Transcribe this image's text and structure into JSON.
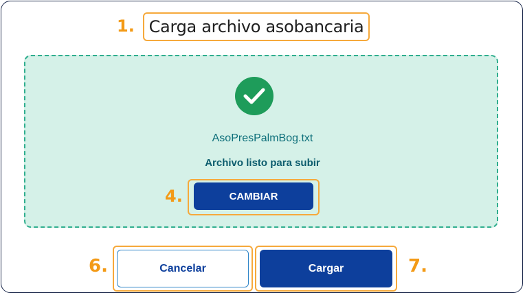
{
  "dialog": {
    "title": "Carga archivo asobancaria",
    "filename": "AsoPresPalmBog.txt",
    "status": "Archivo listo para subir",
    "change_label": "CAMBIAR",
    "cancel_label": "Cancelar",
    "upload_label": "Cargar"
  },
  "annotations": {
    "step1": "1.",
    "step4": "4.",
    "step6": "6.",
    "step7": "7."
  },
  "colors": {
    "accent_orange": "#f39a16",
    "primary_blue": "#0d3f9c",
    "dropzone_bg": "#d5f1e8",
    "dropzone_border": "#2fae8e",
    "success_green": "#1e9c5a"
  },
  "icons": {
    "status": "check-circle-icon"
  }
}
